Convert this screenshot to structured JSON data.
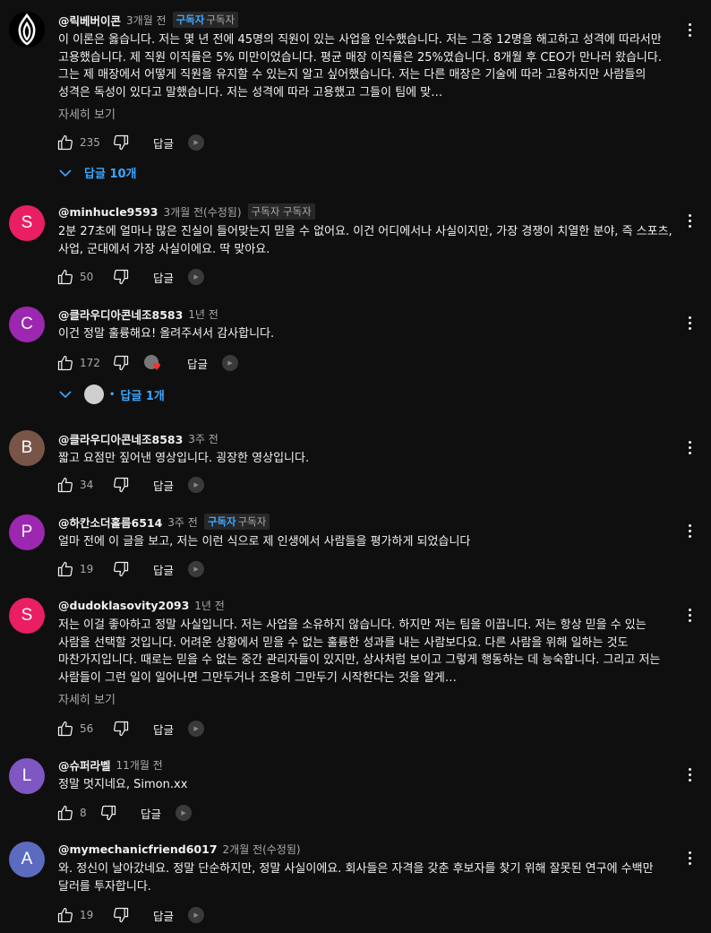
{
  "comments": [
    {
      "author": "@릭베버이콘",
      "time": "3개월 전",
      "badge_strong": "구독자",
      "badge_text": "구독자",
      "text": "이 이론은 옳습니다. 저는 몇 년 전에 45명의 직원이 있는 사업을 인수했습니다. 저는 그중 12명을 해고하고 성격에 따라서만 고용했습니다. 제 직원 이직률은 5% 미만이었습니다. 평균 매장 이직률은 25%였습니다. 8개월 후 CEO가 만나러 왔습니다. 그는 제 매장에서 어떻게 직원을 유지할 수 있는지 알고 싶어했습니다. 저는 다른 매장은 기술에 따라 고용하지만 사람들의 성격은 독성이 있다고 말했습니다. 저는 성격에 따라 고용했고 그들이 팀에 맞…",
      "more": "자세히 보기",
      "likes": "235",
      "reply_label": "답글",
      "replies": "답글 10개",
      "avatar_letter": "",
      "avatar_color": "#000000"
    },
    {
      "author": "@minhucle9593",
      "time": "3개월 전(수정됨)",
      "badge_strong": "",
      "badge_text": "구독자 구독자",
      "text": "2분 27초에 얼마나 많은 진실이 들어맞는지 믿을 수 없어요. 이건 어디에서나 사실이지만, 가장 경쟁이 치열한 분야, 즉 스포츠, 사업, 군대에서 가장 사실이에요. 딱 맞아요.",
      "likes": "50",
      "reply_label": "답글",
      "avatar_letter": "S",
      "avatar_color": "#e91e63"
    },
    {
      "author": "@클라우디아콘네조8583",
      "time": "1년 전",
      "text": "이건 정말 훌륭해요! 올려주셔서 감사합니다.",
      "likes": "172",
      "reply_label": "답글",
      "replies": "답글 1개",
      "avatar_letter": "C",
      "avatar_color": "#9c27b0"
    },
    {
      "author": "@클라우디아콘네조8583",
      "time": "3주 전",
      "text": "짧고 요점만 짚어낸 영상입니다. 굉장한 영상입니다.",
      "likes": "34",
      "reply_label": "답글",
      "avatar_letter": "B",
      "avatar_color": "#795548"
    },
    {
      "author": "@하칸소더홀름6514",
      "time": "3주 전",
      "badge_strong": "구독자",
      "badge_text": "구독자",
      "text": "얼마 전에 이 글을 보고, 저는 이런 식으로 제 인생에서 사람들을 평가하게 되었습니다",
      "likes": "19",
      "reply_label": "답글",
      "avatar_letter": "P",
      "avatar_color": "#9c27b0"
    },
    {
      "author": "@dudoklasovity2093",
      "time": "1년 전",
      "text": "저는 이걸 좋아하고 정말 사실입니다. 저는 사업을 소유하지 않습니다. 하지만 저는 팀을 이끕니다. 저는 항상 믿을 수 있는 사람을 선택할 것입니다. 어려운 상황에서 믿을 수 없는 훌륭한 성과를 내는 사람보다요. 다른 사람을 위해 일하는 것도 마찬가지입니다. 때로는 믿을 수 없는 중간 관리자들이 있지만, 상사처럼 보이고 그렇게 행동하는 데 능숙합니다. 그리고 저는 사람들이 그런 일이 일어나면 그만두거나 조용히 그만두기 시작한다는 것을 알게…",
      "more": "자세히 보기",
      "likes": "56",
      "reply_label": "답글",
      "avatar_letter": "S",
      "avatar_color": "#e91e63"
    },
    {
      "author": "@슈퍼라벨",
      "time": "11개월 전",
      "text": "정말 멋지네요, Simon.xx",
      "likes": "8",
      "reply_label": "답글",
      "avatar_letter": "L",
      "avatar_color": "#7e57c2"
    },
    {
      "author": "@mymechanicfriend6017",
      "time": "2개월 전(수정됨)",
      "text": "와. 정신이 날아갔네요. 정말 단순하지만, 정말 사실이에요. 회사들은 자격을 갖춘 후보자를 찾기 위해 잘못된 연구에 수백만 달러를 투자합니다.",
      "likes": "19",
      "reply_label": "답글",
      "avatar_letter": "A",
      "avatar_color": "#5c6bc0"
    }
  ]
}
